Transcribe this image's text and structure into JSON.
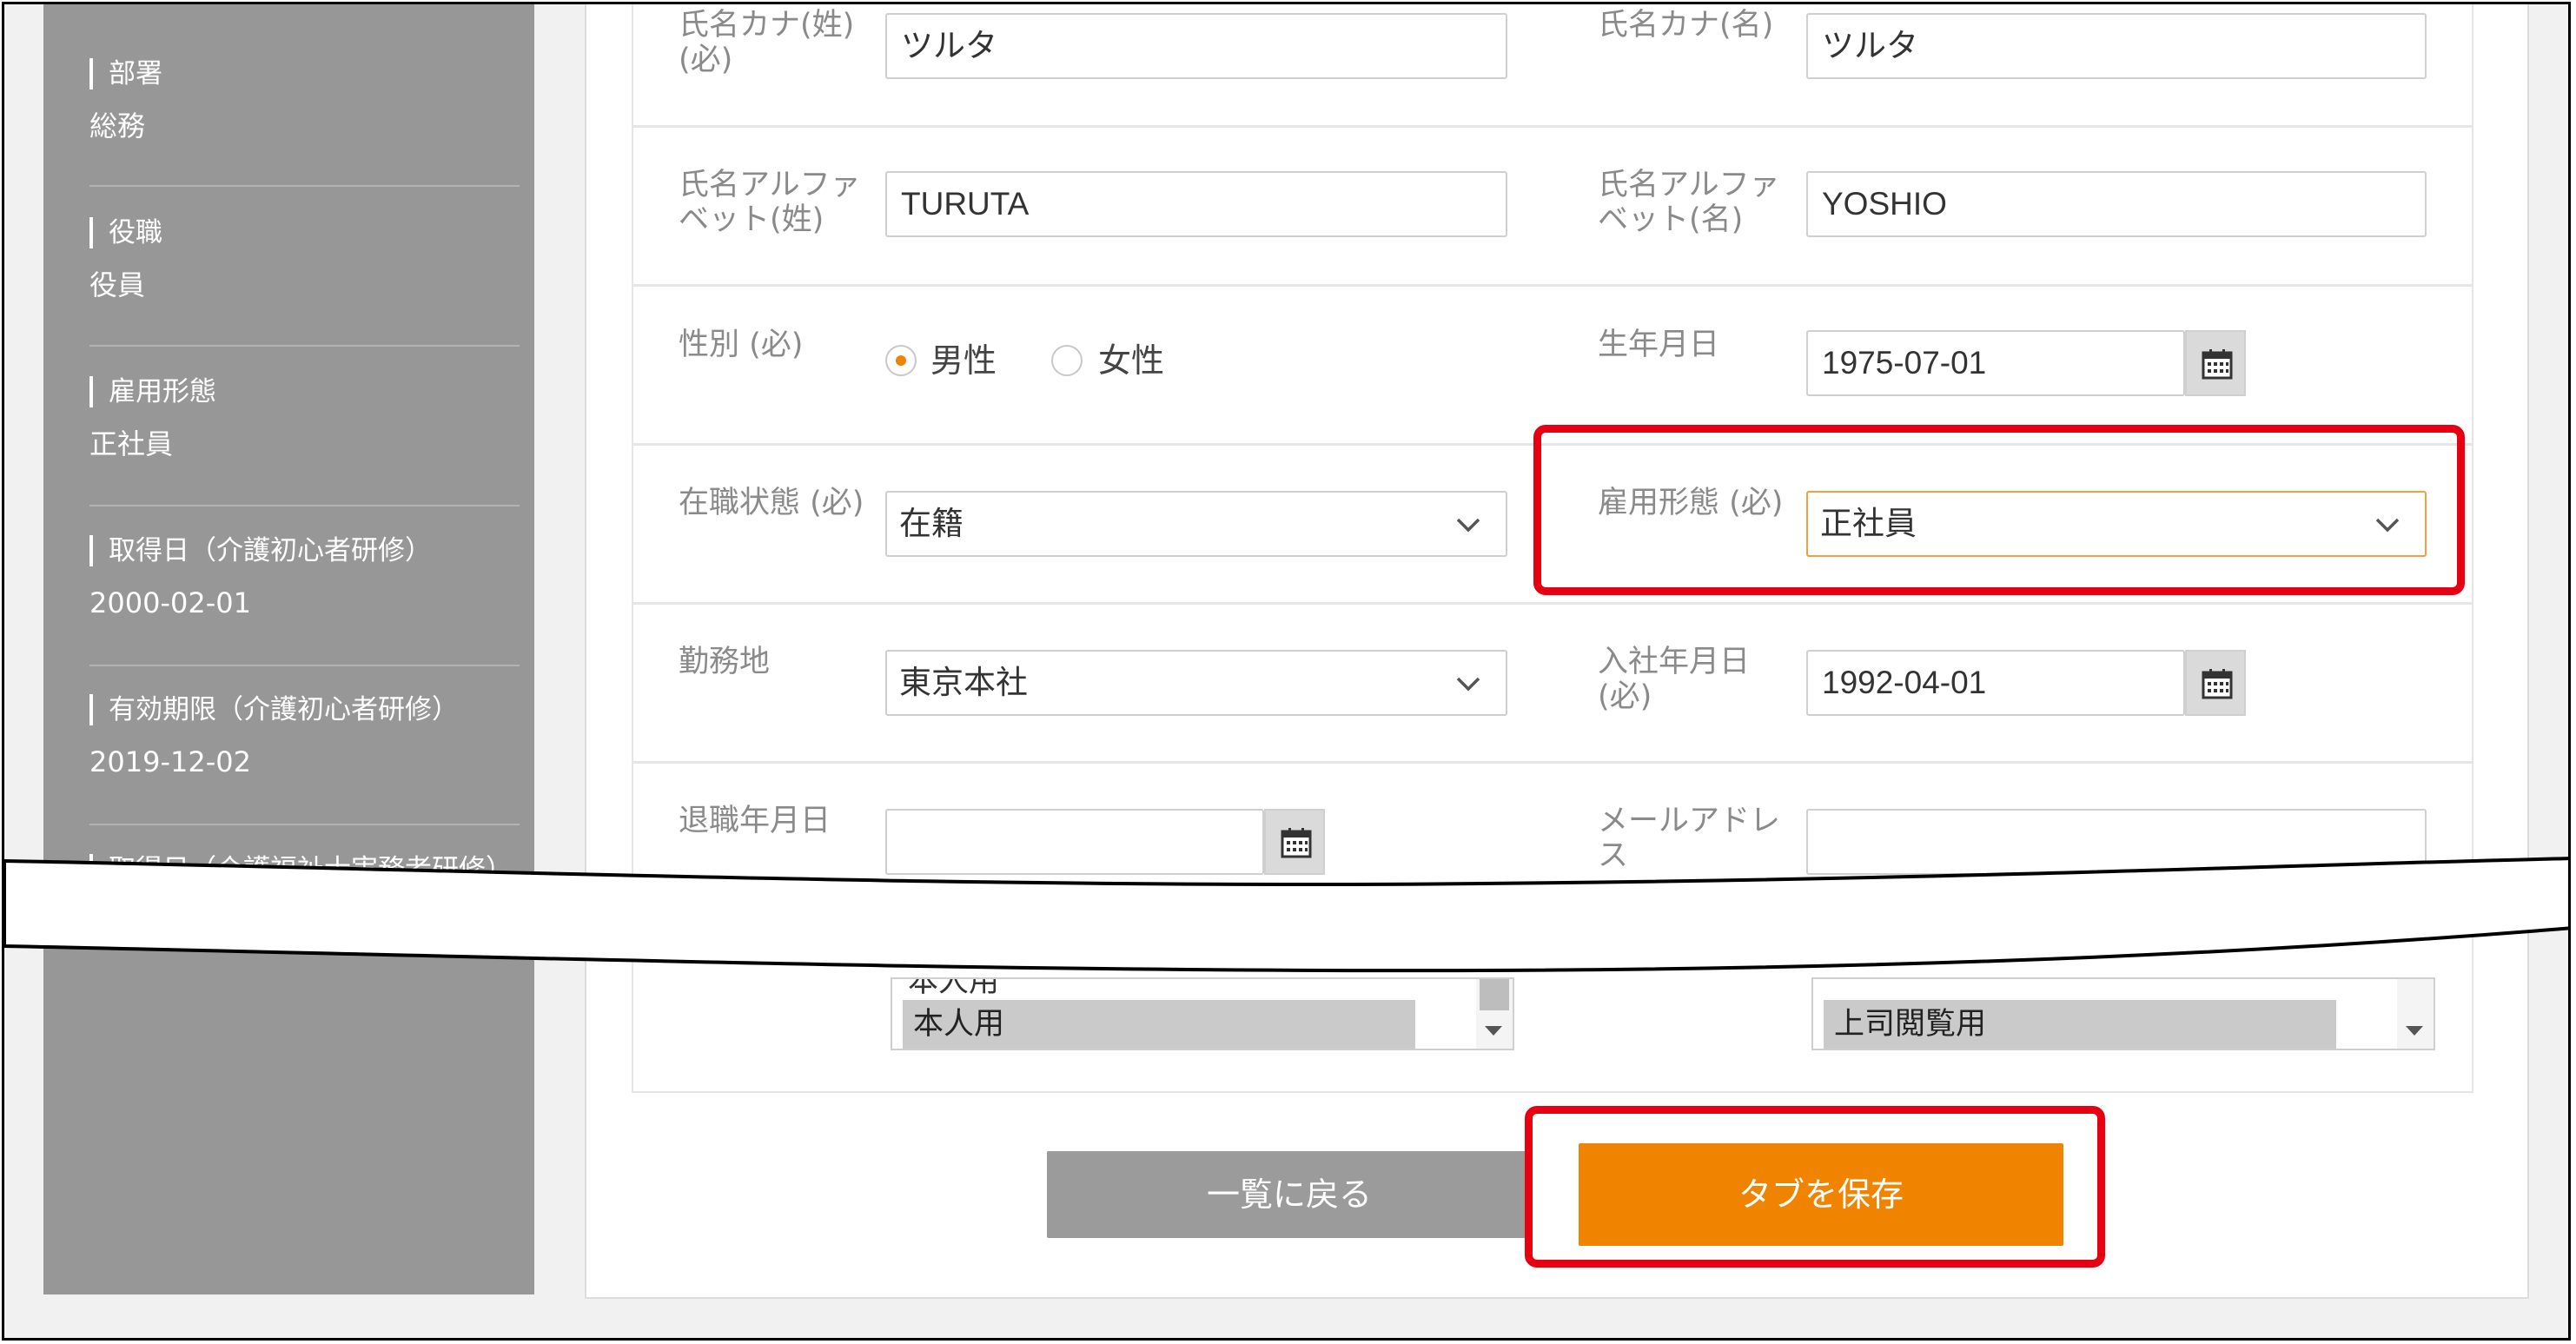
{
  "sidebar": {
    "items": [
      {
        "label": "部署",
        "value": "総務"
      },
      {
        "label": "役職",
        "value": "役員"
      },
      {
        "label": "雇用形態",
        "value": "正社員"
      },
      {
        "label": "取得日（介護初心者研修）",
        "value": "2000-02-01"
      },
      {
        "label": "有効期限（介護初心者研修）",
        "value": "2019-12-02"
      },
      {
        "label": "取得日（介護福祉士実務者研修）",
        "value": ""
      }
    ]
  },
  "form": {
    "kana_sei": {
      "label_line1": "氏名カナ(姓)",
      "label_line2": "(必)",
      "value": "ツルタ"
    },
    "kana_mei": {
      "label": "氏名カナ(名)",
      "value": "ツルタ"
    },
    "alpha_sei": {
      "label_line1": "氏名アルファ",
      "label_line2": "ベット(姓)",
      "value": "TURUTA"
    },
    "alpha_mei": {
      "label_line1": "氏名アルファ",
      "label_line2": "ベット(名)",
      "value": "YOSHIO"
    },
    "gender": {
      "label": "性別 (必)",
      "options": [
        "男性",
        "女性"
      ],
      "selected": "男性"
    },
    "birthdate": {
      "label": "生年月日",
      "value": "1975-07-01"
    },
    "employment_status": {
      "label": "在職状態 (必)",
      "value": "在籍"
    },
    "employment_type": {
      "label": "雇用形態 (必)",
      "value": "正社員"
    },
    "workplace": {
      "label": "勤務地",
      "value": "東京本社"
    },
    "hire_date": {
      "label_line1": "入社年月日",
      "label_line2": "(必)",
      "value": "1992-04-01"
    },
    "retire_date": {
      "label": "退職年月日",
      "value": ""
    },
    "email": {
      "label_line1": "メールアドレ",
      "label_line2": "ス",
      "value": ""
    },
    "list_left": {
      "option_above": "本人用",
      "selected": "本人用"
    },
    "list_right": {
      "selected": "上司閲覧用"
    }
  },
  "buttons": {
    "back": "一覧に戻る",
    "save": "タブを保存"
  },
  "colors": {
    "accent": "#f08300",
    "highlight": "#e60012",
    "sidebar_bg": "#979797"
  }
}
